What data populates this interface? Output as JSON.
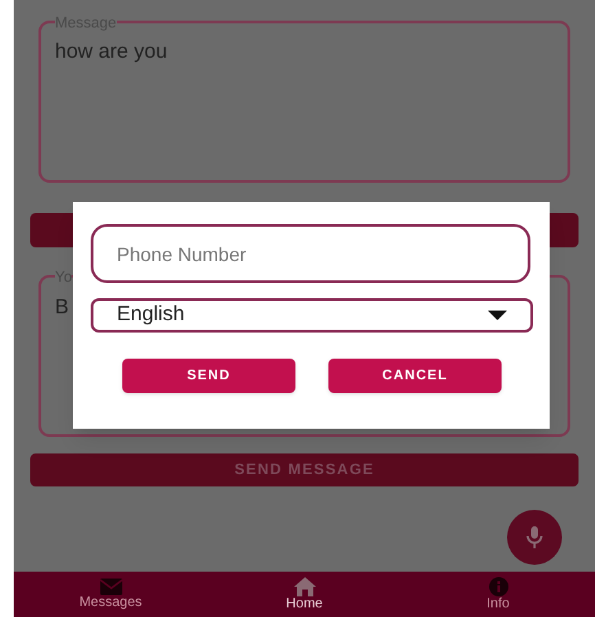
{
  "message_field": {
    "label": "Message",
    "value": "how are you"
  },
  "reply_field": {
    "label": "Yo",
    "value": "B"
  },
  "send_message_button": "SEND MESSAGE",
  "nav": [
    {
      "label": "Messages",
      "kind": "mail",
      "selected": false
    },
    {
      "label": "Home",
      "kind": "home",
      "selected": true
    },
    {
      "label": "Info",
      "kind": "info",
      "selected": false
    }
  ],
  "dialog": {
    "phone_field": {
      "placeholder": "Phone Number"
    },
    "language": "English",
    "buttons": [
      "SEND",
      "CANCEL"
    ]
  }
}
